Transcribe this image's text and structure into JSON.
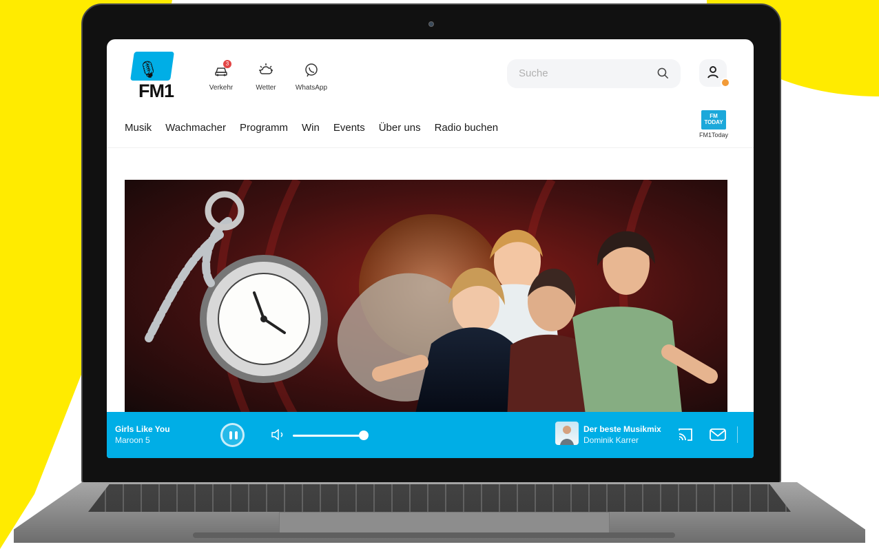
{
  "brand": {
    "accent": "#00aee6",
    "yellow": "#ffeb00"
  },
  "header": {
    "logo_text": "FM1",
    "quick_links": [
      {
        "label": "Verkehr",
        "icon": "traffic-icon",
        "badge": "3"
      },
      {
        "label": "Wetter",
        "icon": "weather-icon"
      },
      {
        "label": "WhatsApp",
        "icon": "whatsapp-icon"
      }
    ],
    "search": {
      "placeholder": "Suche",
      "icon": "search-icon"
    },
    "account_icon": "user-icon"
  },
  "navigation": [
    "Musik",
    "Wachmacher",
    "Programm",
    "Win",
    "Events",
    "Über uns",
    "Radio buchen"
  ],
  "today": {
    "label": "FM1Today",
    "logo_text": "FM TODAY"
  },
  "player": {
    "song": "Girls Like You",
    "artist": "Maroon 5",
    "volume": 100,
    "show": "Der beste Musikmix",
    "host": "Dominik Karrer",
    "icons": [
      "pause-icon",
      "volume-icon",
      "cast-icon",
      "mail-icon"
    ]
  }
}
